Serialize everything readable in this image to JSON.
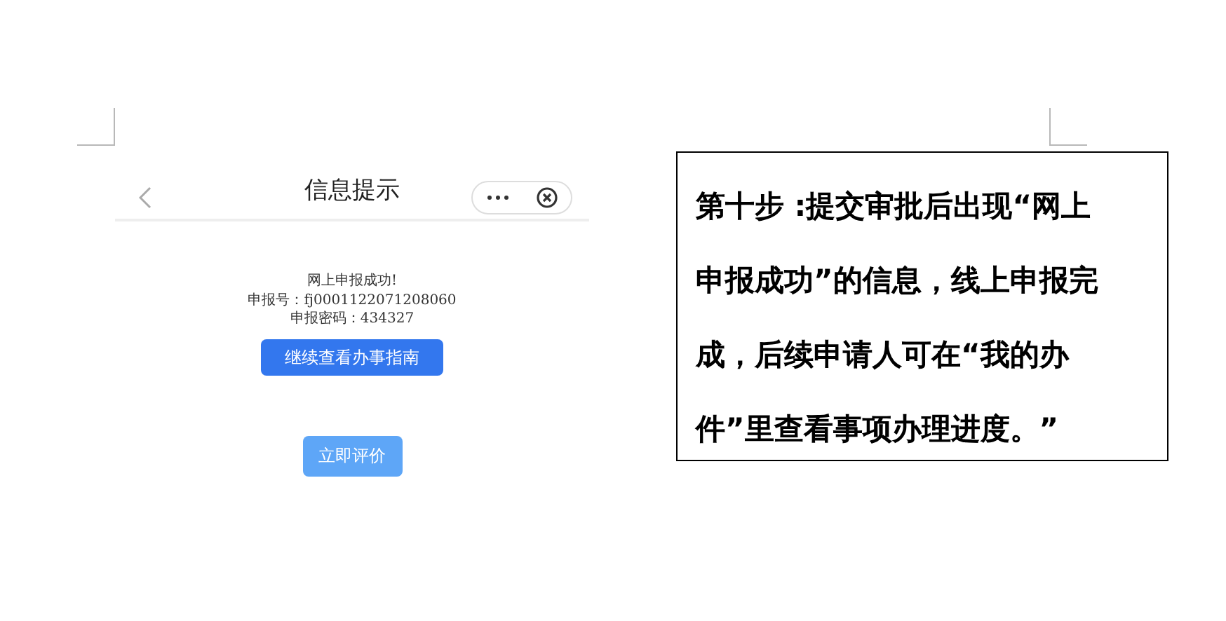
{
  "screenshot": {
    "title": "信息提示",
    "messages": [
      "网上申报成功!",
      "申报号：fj0001122071208060",
      "申报密码：434327"
    ],
    "buttons": [
      {
        "label": "继续查看办事指南",
        "kind": "primary"
      },
      {
        "label": "立即评价",
        "kind": "light"
      }
    ]
  },
  "text_box": "第十步 :提交审批后出现“网上申报成功”的信息，线上申报完成，后续申请人可在“我的办件”里查看事项办理进度。”"
}
